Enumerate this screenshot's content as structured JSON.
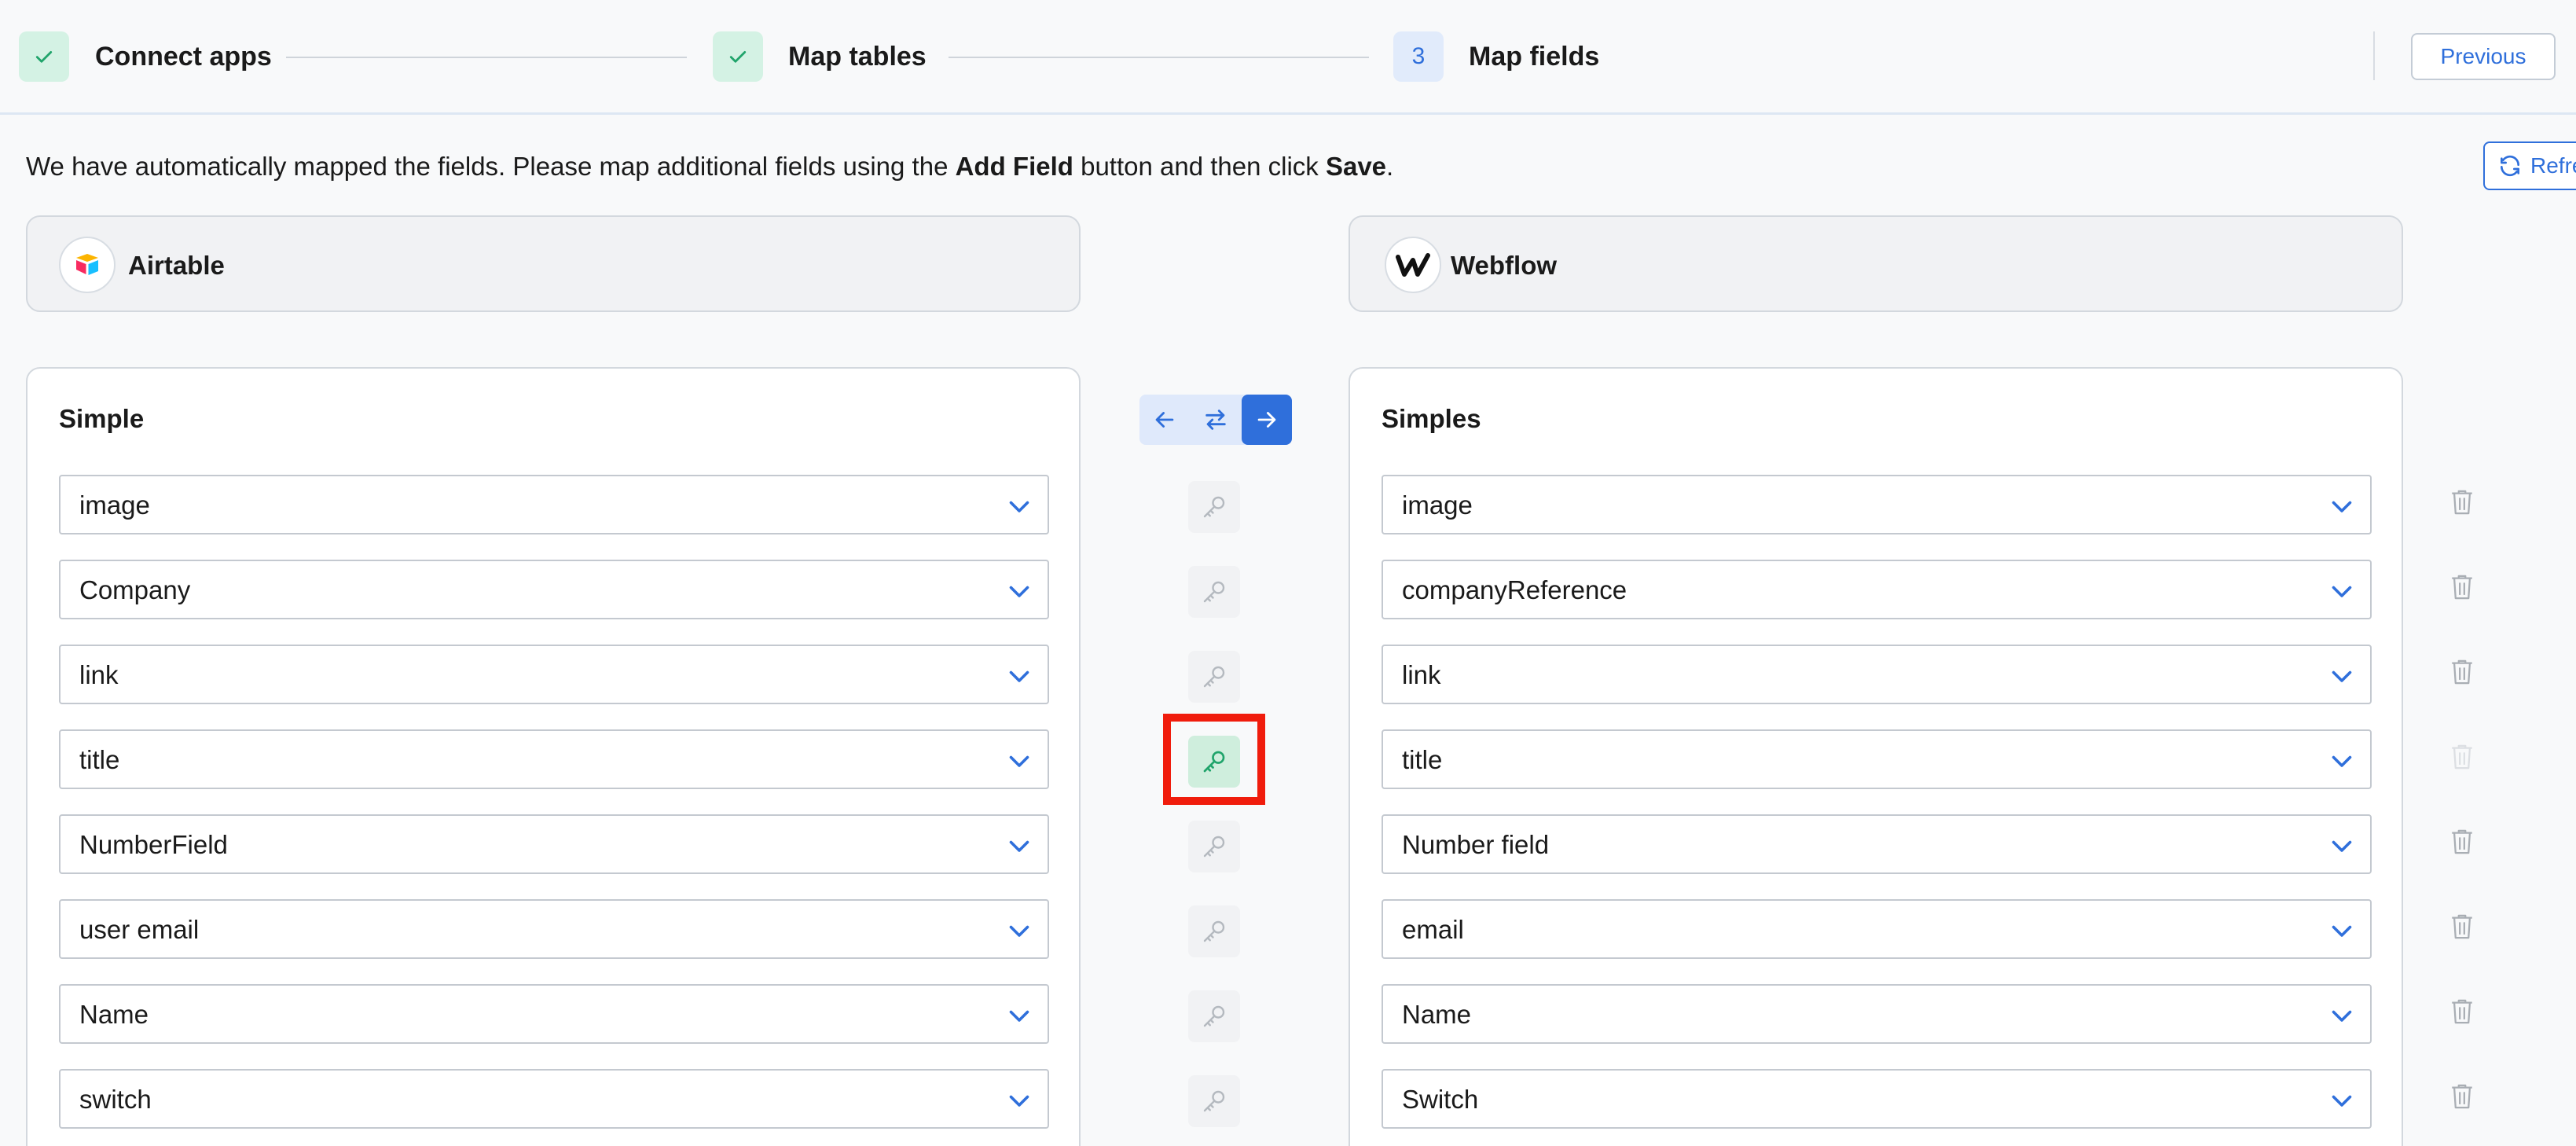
{
  "stepper": {
    "steps": [
      {
        "label": "Connect apps",
        "state": "done"
      },
      {
        "label": "Map tables",
        "state": "done"
      },
      {
        "label": "Map fields",
        "state": "current",
        "number": "3"
      }
    ],
    "previous_label": "Previous"
  },
  "instruction": {
    "part1": "We have automatically mapped the fields. Please map additional fields using the ",
    "bold1": "Add Field",
    "part2": " button and then click ",
    "bold2": "Save",
    "part3": "."
  },
  "refresh_label": "Refresh",
  "source_app": {
    "name": "Airtable",
    "icon": "airtable-logo"
  },
  "target_app": {
    "name": "Webflow",
    "icon": "webflow-logo"
  },
  "source_table": {
    "title": "Simple"
  },
  "target_table": {
    "title": "Simples"
  },
  "direction": {
    "options": [
      "left",
      "both",
      "right"
    ],
    "selected": "right"
  },
  "mappings": [
    {
      "source": "image",
      "target": "image",
      "primary_key": false
    },
    {
      "source": "Company",
      "target": "companyReference",
      "primary_key": false
    },
    {
      "source": "link",
      "target": "link",
      "primary_key": false
    },
    {
      "source": "title",
      "target": "title",
      "primary_key": true
    },
    {
      "source": "NumberField",
      "target": "Number field",
      "primary_key": false
    },
    {
      "source": "user email",
      "target": "email",
      "primary_key": false
    },
    {
      "source": "Name",
      "target": "Name",
      "primary_key": false
    },
    {
      "source": "switch",
      "target": "Switch",
      "primary_key": false
    }
  ],
  "colors": {
    "accent": "#2f6fdb",
    "success_bg": "#d4f2e4",
    "success": "#20a46b",
    "highlight": "#f01c0c"
  }
}
